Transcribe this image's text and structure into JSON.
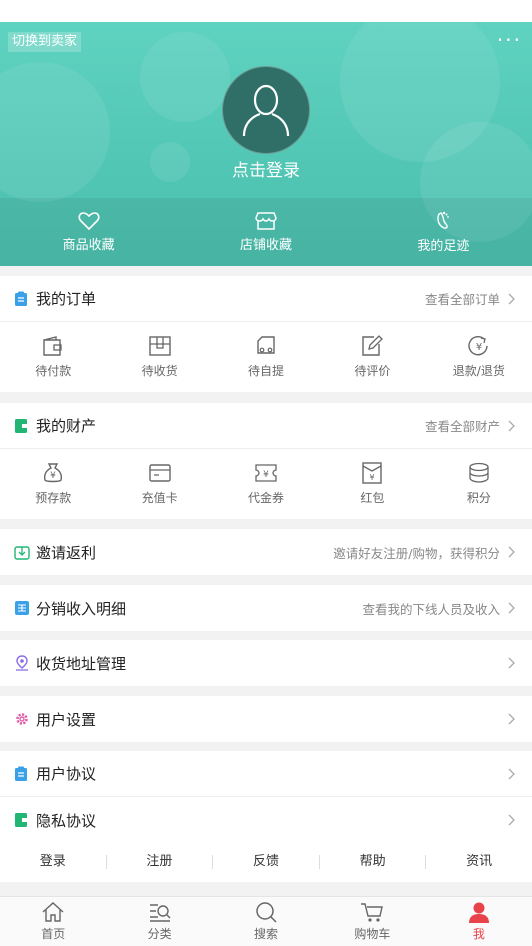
{
  "header": {
    "switch_label": "切换到卖家",
    "more_label": "···",
    "login_label": "点击登录"
  },
  "favorites": [
    {
      "label": "商品收藏",
      "icon": "heart-icon"
    },
    {
      "label": "店铺收藏",
      "icon": "shop-icon"
    },
    {
      "label": "我的足迹",
      "icon": "footprint-icon"
    }
  ],
  "orders": {
    "title": "我的订单",
    "link": "查看全部订单",
    "items": [
      {
        "label": "待付款",
        "icon": "wallet-icon"
      },
      {
        "label": "待收货",
        "icon": "box-icon"
      },
      {
        "label": "待自提",
        "icon": "truck-icon"
      },
      {
        "label": "待评价",
        "icon": "edit-icon"
      },
      {
        "label": "退款/退货",
        "icon": "refund-icon"
      }
    ]
  },
  "assets": {
    "title": "我的财产",
    "link": "查看全部财产",
    "items": [
      {
        "label": "预存款",
        "icon": "money-bag-icon"
      },
      {
        "label": "充值卡",
        "icon": "card-icon"
      },
      {
        "label": "代金券",
        "icon": "voucher-icon"
      },
      {
        "label": "红包",
        "icon": "red-packet-icon"
      },
      {
        "label": "积分",
        "icon": "coins-icon"
      }
    ]
  },
  "invite": {
    "title": "邀请返利",
    "link": "邀请好友注册/购物，获得积分"
  },
  "distribution": {
    "title": "分销收入明细",
    "link": "查看我的下线人员及收入"
  },
  "address": {
    "title": "收货地址管理"
  },
  "settings": {
    "title": "用户设置"
  },
  "agreement": {
    "title": "用户协议"
  },
  "privacy": {
    "title": "隐私协议"
  },
  "footer_links": [
    "登录",
    "注册",
    "反馈",
    "帮助",
    "资讯"
  ],
  "tabs": [
    {
      "label": "首页",
      "icon": "home-icon"
    },
    {
      "label": "分类",
      "icon": "category-icon"
    },
    {
      "label": "搜索",
      "icon": "search-icon"
    },
    {
      "label": "购物车",
      "icon": "cart-icon"
    },
    {
      "label": "我",
      "icon": "user-icon",
      "active": true
    }
  ],
  "colors": {
    "brand": "#52c6b4",
    "active_tab": "#e8424a",
    "blue_icon": "#3aa0e8",
    "green_icon": "#22b573",
    "purple_icon": "#8a6de9",
    "pink_icon": "#e05fa8"
  }
}
